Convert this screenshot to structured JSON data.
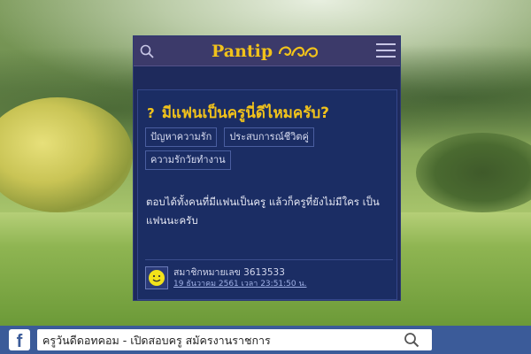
{
  "header": {
    "logo_text": "Pantip",
    "search_icon": "search-icon",
    "menu_icon": "hamburger-menu-icon"
  },
  "topic": {
    "title_icon": "?",
    "title": "มีแฟนเป็นครูนี่ดีไหมครับ?",
    "tags": [
      "ปัญหาความรัก",
      "ประสบการณ์ชีวิตคู่",
      "ความรักวัยทำงาน"
    ],
    "body": "ตอบได้ทั้งคนที่มีแฟนเป็นครู แล้วก็ครูที่ยังไม่มีใคร เป็นแฟนนะครับ",
    "author": "สมาชิกหมายเลข 3613533",
    "timestamp": "19 ธันวาคม 2561 เวลา 23:51:50 น."
  },
  "bottom_bar": {
    "facebook_icon": "f",
    "search_text": "ครูวันดีดอทคอม - เปิดสอบครู สมัครงานราชการ"
  },
  "colors": {
    "accent_yellow": "#f1c21b",
    "card_bg": "#1e2a5c",
    "topbar_bg": "#3c3a6a",
    "facebook_blue": "#3b5b99"
  }
}
